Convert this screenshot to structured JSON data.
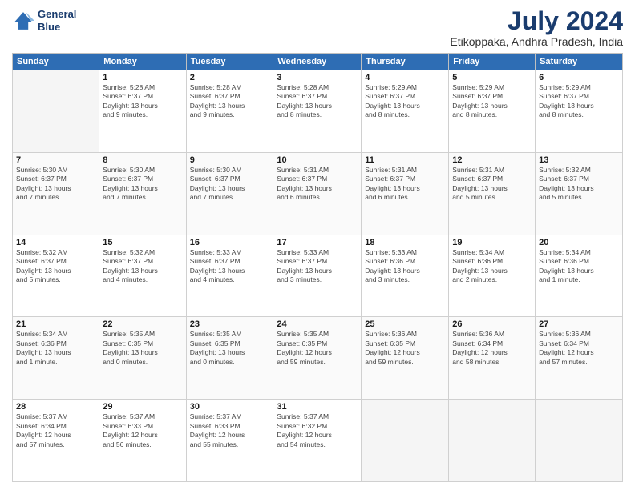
{
  "header": {
    "logo_line1": "General",
    "logo_line2": "Blue",
    "month": "July 2024",
    "location": "Etikoppaka, Andhra Pradesh, India"
  },
  "days_of_week": [
    "Sunday",
    "Monday",
    "Tuesday",
    "Wednesday",
    "Thursday",
    "Friday",
    "Saturday"
  ],
  "weeks": [
    [
      {
        "day": "",
        "info": ""
      },
      {
        "day": "1",
        "info": "Sunrise: 5:28 AM\nSunset: 6:37 PM\nDaylight: 13 hours\nand 9 minutes."
      },
      {
        "day": "2",
        "info": "Sunrise: 5:28 AM\nSunset: 6:37 PM\nDaylight: 13 hours\nand 9 minutes."
      },
      {
        "day": "3",
        "info": "Sunrise: 5:28 AM\nSunset: 6:37 PM\nDaylight: 13 hours\nand 8 minutes."
      },
      {
        "day": "4",
        "info": "Sunrise: 5:29 AM\nSunset: 6:37 PM\nDaylight: 13 hours\nand 8 minutes."
      },
      {
        "day": "5",
        "info": "Sunrise: 5:29 AM\nSunset: 6:37 PM\nDaylight: 13 hours\nand 8 minutes."
      },
      {
        "day": "6",
        "info": "Sunrise: 5:29 AM\nSunset: 6:37 PM\nDaylight: 13 hours\nand 8 minutes."
      }
    ],
    [
      {
        "day": "7",
        "info": "Sunrise: 5:30 AM\nSunset: 6:37 PM\nDaylight: 13 hours\nand 7 minutes."
      },
      {
        "day": "8",
        "info": "Sunrise: 5:30 AM\nSunset: 6:37 PM\nDaylight: 13 hours\nand 7 minutes."
      },
      {
        "day": "9",
        "info": "Sunrise: 5:30 AM\nSunset: 6:37 PM\nDaylight: 13 hours\nand 7 minutes."
      },
      {
        "day": "10",
        "info": "Sunrise: 5:31 AM\nSunset: 6:37 PM\nDaylight: 13 hours\nand 6 minutes."
      },
      {
        "day": "11",
        "info": "Sunrise: 5:31 AM\nSunset: 6:37 PM\nDaylight: 13 hours\nand 6 minutes."
      },
      {
        "day": "12",
        "info": "Sunrise: 5:31 AM\nSunset: 6:37 PM\nDaylight: 13 hours\nand 5 minutes."
      },
      {
        "day": "13",
        "info": "Sunrise: 5:32 AM\nSunset: 6:37 PM\nDaylight: 13 hours\nand 5 minutes."
      }
    ],
    [
      {
        "day": "14",
        "info": "Sunrise: 5:32 AM\nSunset: 6:37 PM\nDaylight: 13 hours\nand 5 minutes."
      },
      {
        "day": "15",
        "info": "Sunrise: 5:32 AM\nSunset: 6:37 PM\nDaylight: 13 hours\nand 4 minutes."
      },
      {
        "day": "16",
        "info": "Sunrise: 5:33 AM\nSunset: 6:37 PM\nDaylight: 13 hours\nand 4 minutes."
      },
      {
        "day": "17",
        "info": "Sunrise: 5:33 AM\nSunset: 6:37 PM\nDaylight: 13 hours\nand 3 minutes."
      },
      {
        "day": "18",
        "info": "Sunrise: 5:33 AM\nSunset: 6:36 PM\nDaylight: 13 hours\nand 3 minutes."
      },
      {
        "day": "19",
        "info": "Sunrise: 5:34 AM\nSunset: 6:36 PM\nDaylight: 13 hours\nand 2 minutes."
      },
      {
        "day": "20",
        "info": "Sunrise: 5:34 AM\nSunset: 6:36 PM\nDaylight: 13 hours\nand 1 minute."
      }
    ],
    [
      {
        "day": "21",
        "info": "Sunrise: 5:34 AM\nSunset: 6:36 PM\nDaylight: 13 hours\nand 1 minute."
      },
      {
        "day": "22",
        "info": "Sunrise: 5:35 AM\nSunset: 6:35 PM\nDaylight: 13 hours\nand 0 minutes."
      },
      {
        "day": "23",
        "info": "Sunrise: 5:35 AM\nSunset: 6:35 PM\nDaylight: 13 hours\nand 0 minutes."
      },
      {
        "day": "24",
        "info": "Sunrise: 5:35 AM\nSunset: 6:35 PM\nDaylight: 12 hours\nand 59 minutes."
      },
      {
        "day": "25",
        "info": "Sunrise: 5:36 AM\nSunset: 6:35 PM\nDaylight: 12 hours\nand 59 minutes."
      },
      {
        "day": "26",
        "info": "Sunrise: 5:36 AM\nSunset: 6:34 PM\nDaylight: 12 hours\nand 58 minutes."
      },
      {
        "day": "27",
        "info": "Sunrise: 5:36 AM\nSunset: 6:34 PM\nDaylight: 12 hours\nand 57 minutes."
      }
    ],
    [
      {
        "day": "28",
        "info": "Sunrise: 5:37 AM\nSunset: 6:34 PM\nDaylight: 12 hours\nand 57 minutes."
      },
      {
        "day": "29",
        "info": "Sunrise: 5:37 AM\nSunset: 6:33 PM\nDaylight: 12 hours\nand 56 minutes."
      },
      {
        "day": "30",
        "info": "Sunrise: 5:37 AM\nSunset: 6:33 PM\nDaylight: 12 hours\nand 55 minutes."
      },
      {
        "day": "31",
        "info": "Sunrise: 5:37 AM\nSunset: 6:32 PM\nDaylight: 12 hours\nand 54 minutes."
      },
      {
        "day": "",
        "info": ""
      },
      {
        "day": "",
        "info": ""
      },
      {
        "day": "",
        "info": ""
      }
    ]
  ]
}
